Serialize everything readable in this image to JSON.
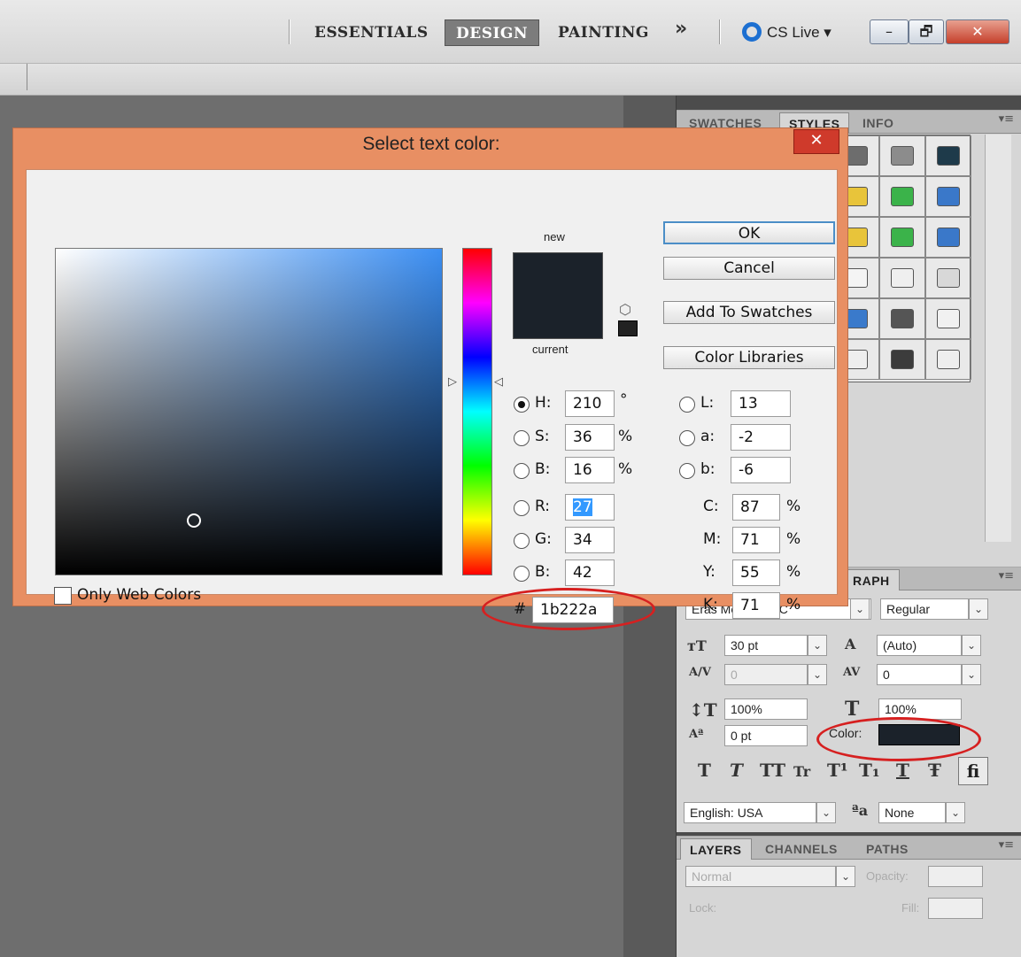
{
  "workspace": {
    "tabs": [
      "ESSENTIALS",
      "DESIGN",
      "PAINTING"
    ],
    "active_tab": "DESIGN",
    "more_label": "»",
    "cs_live_label": "CS Live ▾",
    "window_buttons": [
      "–",
      "🗗",
      "✕"
    ]
  },
  "panels": {
    "styles_tabs": [
      "SWATCHES",
      "STYLES",
      "INFO"
    ],
    "styles_colors": [
      "#6d6d6d",
      "#8c8c8c",
      "#1e3a4a",
      "#e8c43a",
      "#3bb34a",
      "#3a78c9",
      "#e8c43a",
      "#3bb34a",
      "#3a78c9",
      "#f4f4f4",
      "#efefef",
      "#d8d8d8",
      "#3a7acb",
      "#555555",
      "#f1f1f1",
      "#eeeeee",
      "#3c3c3c",
      "#eeeeee"
    ],
    "paragraph_tab_fragment": "RAPH",
    "font_family": "Eras Medium ITC",
    "font_style": "Regular",
    "font_size": "30 pt",
    "leading": "(Auto)",
    "kerning": "0",
    "tracking": "0",
    "vertical_scale": "100%",
    "horizontal_scale": "100%",
    "baseline_shift": "0 pt",
    "color_label": "Color:",
    "color_value": "#1b222a",
    "type_buttons": [
      "T",
      "T",
      "TT",
      "Tr",
      "T¹",
      "T₁",
      "T",
      "Ŧ"
    ],
    "ligature": "fi",
    "language": "English: USA",
    "aa_prefix": "ªa",
    "antialias": "None",
    "layers_tabs": [
      "LAYERS",
      "CHANNELS",
      "PATHS"
    ],
    "blend_mode": "Normal",
    "opacity_label": "Opacity:",
    "lock_label": "Lock:",
    "fill_label": "Fill:"
  },
  "dialog": {
    "title": "Select text color:",
    "close": "✕",
    "new_label": "new",
    "current_label": "current",
    "new_color": "#1b222a",
    "buttons": [
      "OK",
      "Cancel",
      "Add To Swatches",
      "Color Libraries"
    ],
    "only_web_colors": "Only Web Colors",
    "hsb": [
      {
        "label": "H:",
        "value": "210",
        "unit": "°",
        "selected": true
      },
      {
        "label": "S:",
        "value": "36",
        "unit": "%",
        "selected": false
      },
      {
        "label": "B:",
        "value": "16",
        "unit": "%",
        "selected": false
      }
    ],
    "rgb": [
      {
        "label": "R:",
        "value": "27"
      },
      {
        "label": "G:",
        "value": "34"
      },
      {
        "label": "B:",
        "value": "42"
      }
    ],
    "lab": [
      {
        "label": "L:",
        "value": "13"
      },
      {
        "label": "a:",
        "value": "-2"
      },
      {
        "label": "b:",
        "value": "-6"
      }
    ],
    "cmyk": [
      {
        "label": "C:",
        "value": "87",
        "unit": "%"
      },
      {
        "label": "M:",
        "value": "71",
        "unit": "%"
      },
      {
        "label": "Y:",
        "value": "55",
        "unit": "%"
      },
      {
        "label": "K:",
        "value": "71",
        "unit": "%"
      }
    ],
    "hex_prefix": "#",
    "hex_value": "1b222a"
  }
}
